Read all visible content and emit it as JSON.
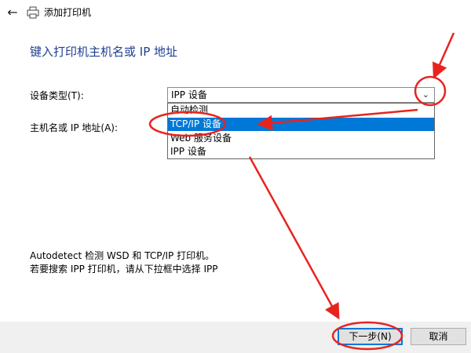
{
  "window": {
    "title": "添加打印机",
    "back_icon": "back-arrow-icon",
    "printer_icon": "printer-icon"
  },
  "heading": "键入打印机主机名或 IP 地址",
  "form": {
    "device_type_label": "设备类型(T):",
    "host_label": "主机名或 IP 地址(A):",
    "device_type_value": "IPP 设备",
    "dropdown_options": [
      "自动检测",
      "TCP/IP 设备",
      "Web 服务设备",
      "IPP 设备"
    ],
    "selected_option": "TCP/IP 设备"
  },
  "info": {
    "line1": "Autodetect 检测 WSD 和 TCP/IP 打印机。",
    "line2": "若要搜索 IPP 打印机，请从下拉框中选择 IPP"
  },
  "buttons": {
    "next": "下一步(N)",
    "cancel": "取消"
  },
  "colors": {
    "heading": "#1e3f8f",
    "selection": "#0078d7",
    "annotation": "#e8231f"
  }
}
